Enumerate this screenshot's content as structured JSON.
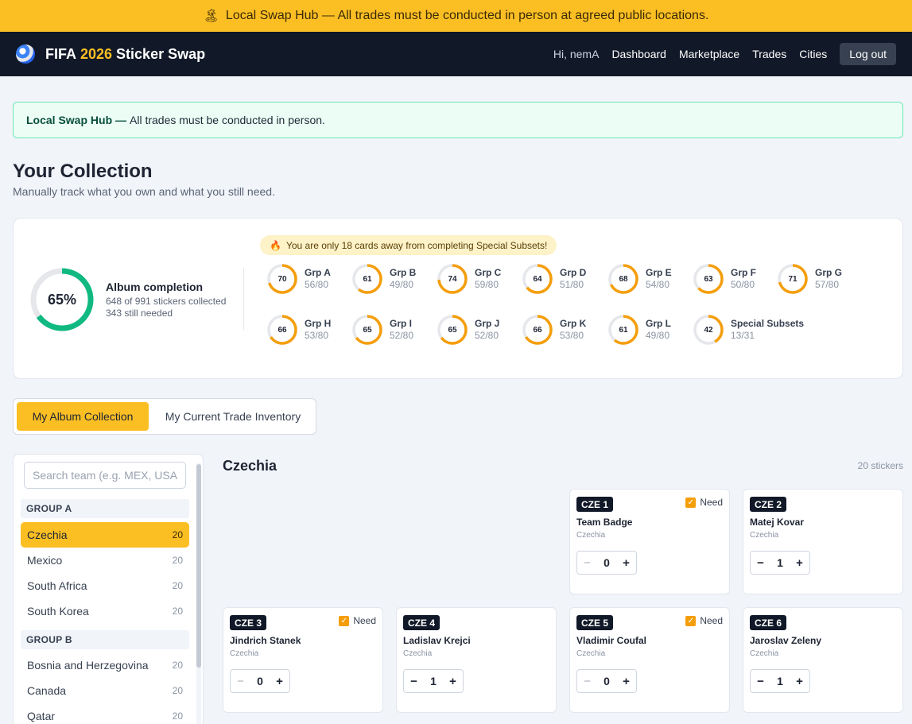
{
  "banner": {
    "text": "Local Swap Hub — All trades must be conducted in person at agreed public locations.",
    "flag": "🏝"
  },
  "nav": {
    "brand_prefix": "FIFA",
    "brand_year": "2026",
    "brand_suffix": "Sticker Swap",
    "greeting": "Hi, nemA",
    "links": [
      "Dashboard",
      "Marketplace",
      "Trades",
      "Cities"
    ],
    "logout": "Log out"
  },
  "alert": {
    "bold": "Local Swap Hub —",
    "text": "All trades must be conducted in person."
  },
  "page": {
    "title": "Your Collection",
    "subtitle": "Manually track what you own and what you still need."
  },
  "stats": {
    "percent_label": "65%",
    "percent": 65,
    "title": "Album completion",
    "collected": "648 of 991 stickers collected",
    "needed": "343 still needed",
    "away_msg": "You are only 18 cards away from completing Special Subsets!",
    "groups": [
      {
        "label": "70",
        "pct": 70,
        "name": "Grp A",
        "count": "56/80"
      },
      {
        "label": "61",
        "pct": 61,
        "name": "Grp B",
        "count": "49/80"
      },
      {
        "label": "74",
        "pct": 74,
        "name": "Grp C",
        "count": "59/80"
      },
      {
        "label": "64",
        "pct": 64,
        "name": "Grp D",
        "count": "51/80"
      },
      {
        "label": "68",
        "pct": 68,
        "name": "Grp E",
        "count": "54/80"
      },
      {
        "label": "63",
        "pct": 63,
        "name": "Grp F",
        "count": "50/80"
      },
      {
        "label": "71",
        "pct": 71,
        "name": "Grp G",
        "count": "57/80"
      },
      {
        "label": "66",
        "pct": 66,
        "name": "Grp H",
        "count": "53/80"
      },
      {
        "label": "65",
        "pct": 65,
        "name": "Grp I",
        "count": "52/80"
      },
      {
        "label": "65",
        "pct": 65,
        "name": "Grp J",
        "count": "52/80"
      },
      {
        "label": "66",
        "pct": 66,
        "name": "Grp K",
        "count": "53/80"
      },
      {
        "label": "61",
        "pct": 61,
        "name": "Grp L",
        "count": "49/80"
      },
      {
        "label": "42",
        "pct": 42,
        "name": "Special Subsets",
        "count": "13/31"
      }
    ]
  },
  "tabs": {
    "album": "My Album Collection",
    "inventory": "My Current Trade Inventory"
  },
  "sidebar": {
    "search_placeholder": "Search team (e.g. MEX, USA)...",
    "group_a": "GROUP A",
    "group_b": "GROUP B",
    "teams_a": [
      {
        "name": "Czechia",
        "count": "20"
      },
      {
        "name": "Mexico",
        "count": "20"
      },
      {
        "name": "South Africa",
        "count": "20"
      },
      {
        "name": "South Korea",
        "count": "20"
      }
    ],
    "teams_b": [
      {
        "name": "Bosnia and Herzegovina",
        "count": "20"
      },
      {
        "name": "Canada",
        "count": "20"
      },
      {
        "name": "Qatar",
        "count": "20"
      }
    ]
  },
  "main": {
    "team_title": "Czechia",
    "sticker_count": "20 stickers",
    "need_label": "Need",
    "cards": [
      {
        "code": "CZE 1",
        "name": "Team Badge",
        "team": "Czechia",
        "qty": "0",
        "need": true
      },
      {
        "code": "CZE 2",
        "name": "Matej Kovar",
        "team": "Czechia",
        "qty": "1",
        "need": false
      },
      {
        "code": "CZE 3",
        "name": "Jindrich Stanek",
        "team": "Czechia",
        "qty": "0",
        "need": true
      },
      {
        "code": "CZE 4",
        "name": "Ladislav Krejci",
        "team": "Czechia",
        "qty": "1",
        "need": false
      },
      {
        "code": "CZE 5",
        "name": "Vladimir Coufal",
        "team": "Czechia",
        "qty": "0",
        "need": true
      },
      {
        "code": "CZE 6",
        "name": "Jaroslav Zeleny",
        "team": "Czechia",
        "qty": "1",
        "need": false
      }
    ],
    "minus": "−",
    "plus": "+"
  }
}
